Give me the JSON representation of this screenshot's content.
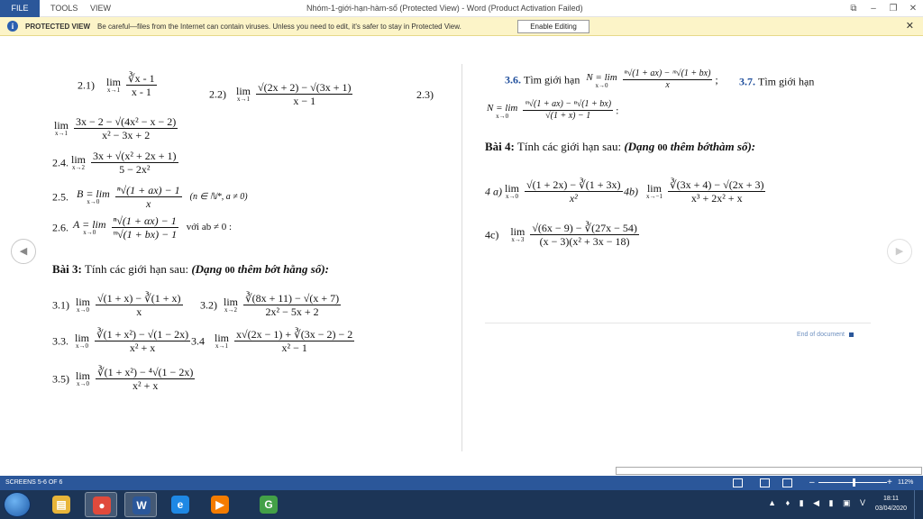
{
  "titlebar": {
    "menu": [
      "FILE",
      "TOOLS",
      "VIEW"
    ],
    "title": "Nhóm-1-giới-hạn-hàm-số (Protected View) - Word (Product Activation Failed)",
    "controls": [
      "⧉",
      "–",
      "❐",
      "✕"
    ]
  },
  "protected_view": {
    "icon": "i",
    "title": "PROTECTED VIEW",
    "message": "Be careful—files from the Internet can contain viruses. Unless you need to edit, it's safer to stay in Protected View.",
    "button": "Enable Editing",
    "close": "✕"
  },
  "document": {
    "left": {
      "e21_label": "2.1)",
      "e21_num": "∛x - 1",
      "e21_den": "x - 1",
      "e21_lim": "lim",
      "e21_sub": "x→1",
      "e22_label": "2.2)",
      "e22_num": "√(2x + 2) − √(3x + 1)",
      "e22_den": "x − 1",
      "e22_lim": "lim",
      "e22_sub": "x→1",
      "e23_label": "2.3)",
      "e23_num": "3x − 2 − √(4x² − x − 2)",
      "e23_den": "x² − 3x + 2",
      "e23_lim": "lim",
      "e23_sub": "x→1",
      "e24_label": "2.4.",
      "e24_num": "3x + √(x² + 2x + 1)",
      "e24_den": "5 − 2x²",
      "e24_lim": "lim",
      "e24_sub": "x→2",
      "e25_label": "2.5.",
      "e25_prefix": "B = lim",
      "e25_num": "ⁿ√(1 + ax) − 1",
      "e25_den": "x",
      "e25_sub": "x→0",
      "e25_cond": "(n ∈ ℕ*, a ≠ 0)",
      "e26_label": "2.6.",
      "e26_prefix": "A = lim",
      "e26_num": "ⁿ√(1 + αx) − 1",
      "e26_den": "ᵐ√(1 + bx) − 1",
      "e26_sub": "x→0",
      "e26_cond": "với ab ≠ 0 :",
      "bai3_prefix": "Bài 3:",
      "bai3_text": "Tính các giới hạn sau:",
      "bai3_italic": "(Dạng",
      "bai3_frac_num": "0",
      "bai3_frac_den": "0",
      "bai3_italic2": "thêm bớt hằng số):",
      "e31_label": "3.1)",
      "e31_num": "√(1 + x) − ∛(1 + x)",
      "e31_den": "x",
      "e31_lim": "lim",
      "e31_sub": "x→0",
      "e32_label": "3.2)",
      "e32_num": "∛(8x + 11) − √(x + 7)",
      "e32_den": "2x² − 5x + 2",
      "e32_lim": "lim",
      "e32_sub": "x→2",
      "e33_label": "3.3.",
      "e33_num": "∛(1 + x²) − √(1 − 2x)",
      "e33_den": "x² + x",
      "e33_lim": "lim",
      "e33_sub": "x→0",
      "e34_label": "3.4",
      "e34_num": "x√(2x − 1) + ∛(3x − 2) − 2",
      "e34_den": "x² − 1",
      "e34_lim": "lim",
      "e34_sub": "x→1",
      "e35_label": "3.5)",
      "e35_num": "∛(1 + x²) − ⁴√(1 − 2x)",
      "e35_den": "x² + x",
      "e35_lim": "lim",
      "e35_sub": "x→0"
    },
    "right": {
      "e36_label": "3.6.",
      "e36_text": "Tìm giới hạn",
      "e36_prefix": "N = lim",
      "e36_num": "ⁿ√(1 + ax) − ᵐ√(1 + bx)",
      "e36_den": "x",
      "e36_sub": "x→0",
      "e36_tail": ";",
      "e37_label": "3.7.",
      "e37_text": "Tìm giới hạn",
      "e37_prefix": "N = lim",
      "e37_num": "ᵐ√(1 + ax) − ⁿ√(1 + bx)",
      "e37_den": "√(1 + x) − 1",
      "e37_sub": "x→0",
      "e37_tail": ":",
      "bai4_prefix": "Bài 4:",
      "bai4_text": "Tính các giới hạn sau:",
      "bai4_italic": "(Dạng",
      "bai4_frac_num": "0",
      "bai4_frac_den": "0",
      "bai4_italic2": "thêm bớthàm số):",
      "e4a_label": "4 a)",
      "e4a_num": "√(1 + 2x) − ∛(1 + 3x)",
      "e4a_den": "x²",
      "e4a_lim": "lim",
      "e4a_sub": "x→0",
      "e4b_label": "4b)",
      "e4b_num": "∛(3x + 4) − √(2x + 3)",
      "e4b_den": "x³ + 2x² + x",
      "e4b_lim": "lim",
      "e4b_sub": "x→−1",
      "e4c_label": "4c)",
      "e4c_num": "√(6x − 9) − ∛(27x − 54)",
      "e4c_den": "(x − 3)(x² + 3x − 18)",
      "e4c_lim": "lim",
      "e4c_sub": "x→3",
      "end": "End of document"
    },
    "nav_prev": "◀",
    "nav_next": "▶"
  },
  "statusbar": {
    "screens": "SCREENS 5-6 OF 6",
    "zoom_minus": "–",
    "zoom_plus": "+",
    "zoom": "112%",
    "zoom_level_percent": 112
  },
  "taskbar": {
    "apps": [
      {
        "name": "file-explorer",
        "glyph": "▤",
        "color": "#e8b53a"
      },
      {
        "name": "chrome",
        "glyph": "●",
        "color": "#e04a3c"
      },
      {
        "name": "word",
        "glyph": "W",
        "color": "#2b579a"
      },
      {
        "name": "internet-explorer",
        "glyph": "e",
        "color": "#1e88e5"
      },
      {
        "name": "media-player",
        "glyph": "▶",
        "color": "#f57c00"
      },
      {
        "name": "greenshot",
        "glyph": "G",
        "color": "#43a047"
      }
    ],
    "tray": "▲ ♦ ▮ ◀ ▮ ▣ V",
    "time": "18:11",
    "date": "03/04/2020"
  }
}
